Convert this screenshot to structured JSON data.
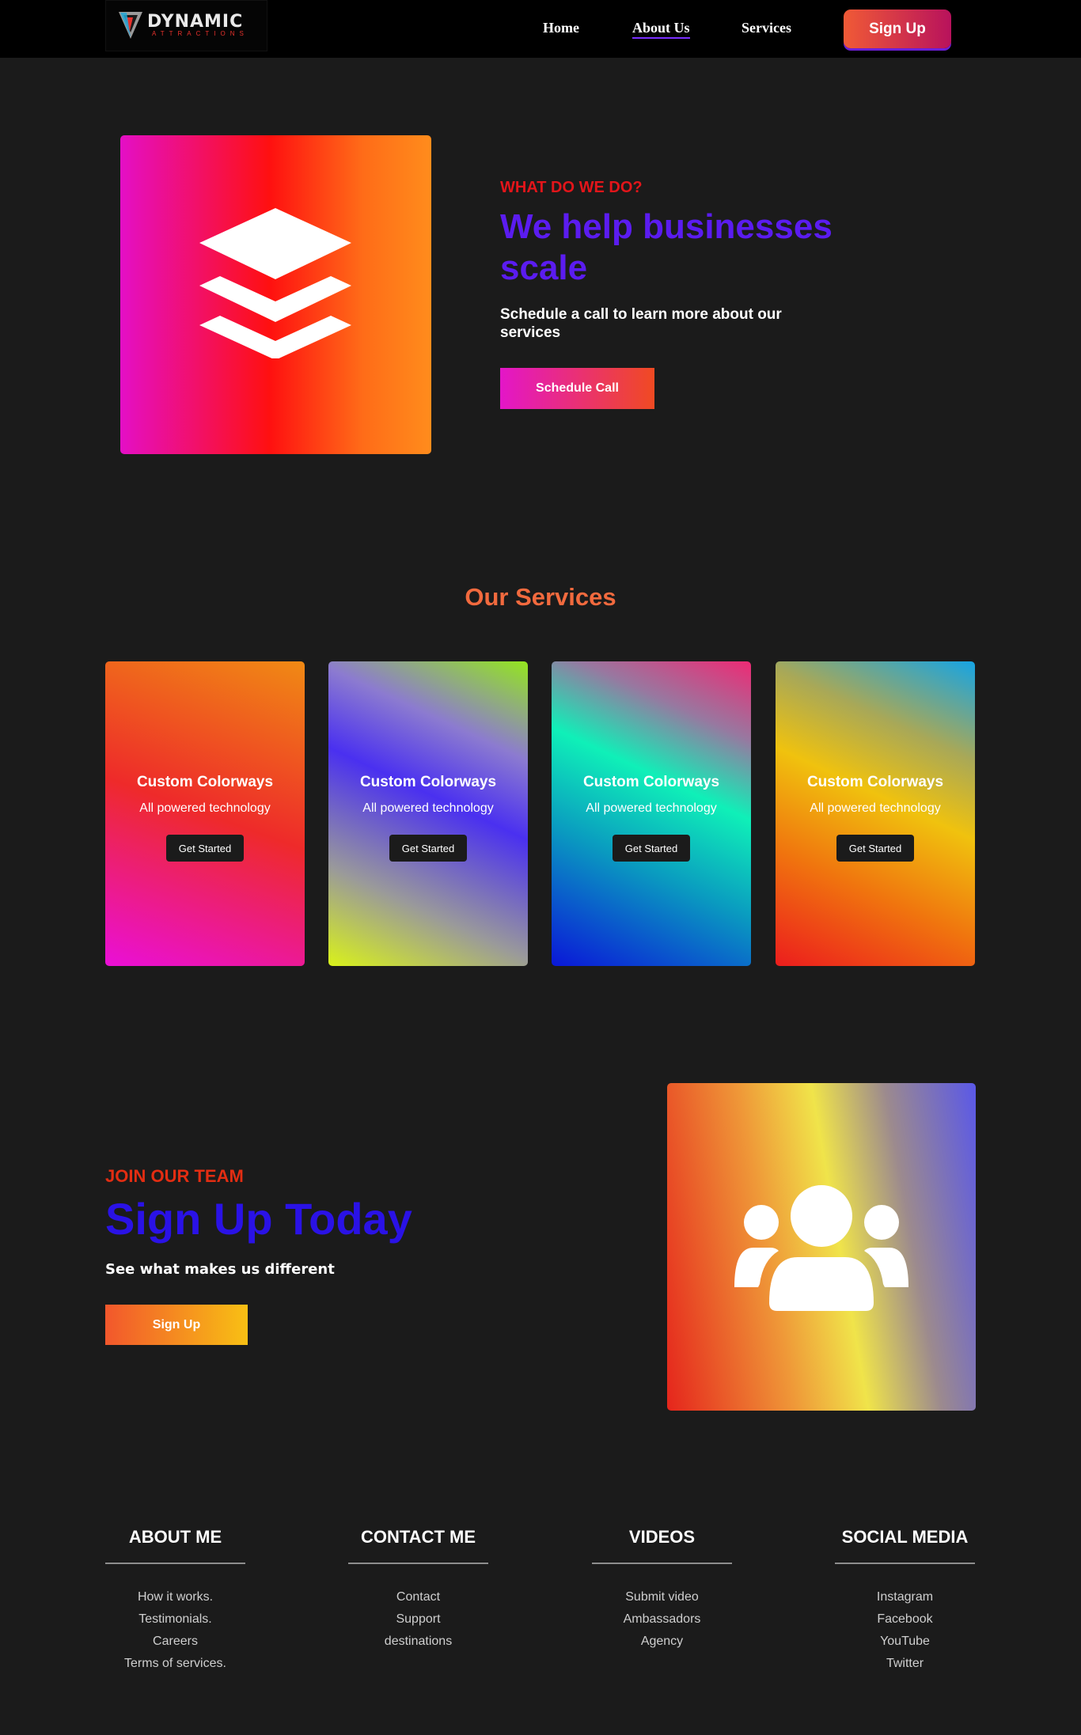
{
  "brand": {
    "name": "DYNAMIC",
    "tagline": "ATTRACTIONS"
  },
  "nav": {
    "links": [
      "Home",
      "About Us",
      "Services"
    ],
    "active": "About Us",
    "signup": "Sign Up"
  },
  "hero": {
    "eyebrow": "WHAT DO WE DO?",
    "title": "We help businesses scale",
    "subtitle": "Schedule a call to learn more about our services",
    "button": "Schedule Call",
    "icon": "layers-icon"
  },
  "services": {
    "title": "Our Services",
    "cards": [
      {
        "title": "Custom Colorways",
        "text": "All powered technology",
        "button": "Get Started"
      },
      {
        "title": "Custom Colorways",
        "text": "All powered technology",
        "button": "Get Started"
      },
      {
        "title": "Custom Colorways",
        "text": "All powered technology",
        "button": "Get Started"
      },
      {
        "title": "Custom Colorways",
        "text": "All powered technology",
        "button": "Get Started"
      }
    ]
  },
  "team": {
    "eyebrow": "JOIN OUR TEAM",
    "title": "Sign Up Today",
    "subtitle": "See what makes us different",
    "button": "Sign Up",
    "icon": "users-icon"
  },
  "footer": {
    "columns": [
      {
        "heading": "ABOUT ME",
        "links": [
          "How it works.",
          "Testimonials.",
          "Careers",
          "Terms of services."
        ]
      },
      {
        "heading": "CONTACT ME",
        "links": [
          "Contact",
          "Support",
          "destinations"
        ]
      },
      {
        "heading": "VIDEOS",
        "links": [
          "Submit video",
          "Ambassadors",
          "Agency"
        ]
      },
      {
        "heading": "SOCIAL MEDIA",
        "links": [
          "Instagram",
          "Facebook",
          "YouTube",
          "Twitter"
        ]
      }
    ]
  },
  "colors": {
    "background": "#1b1b1b",
    "navbar": "#000000",
    "hero_eyebrow": "#e3151a",
    "hero_title": "#5b1cf0",
    "services_title": "#f26a3e",
    "team_eyebrow": "#e32d12",
    "team_title": "#2a12e6"
  }
}
